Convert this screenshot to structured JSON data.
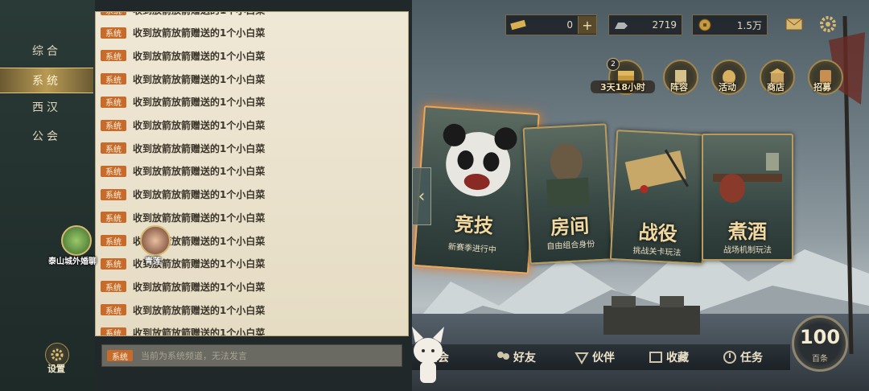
{
  "resources": [
    {
      "icon": "gold-bar-icon",
      "value": "0",
      "has_plus": true
    },
    {
      "icon": "horse-icon",
      "value": "2719",
      "has_plus": false
    },
    {
      "icon": "coin-icon",
      "value": "1.5万",
      "has_plus": false
    }
  ],
  "top_icons": [
    "mail-icon",
    "gear-icon"
  ],
  "menu_buttons": [
    {
      "label": "3天18小时",
      "icon": "chest-icon",
      "badge": "2"
    },
    {
      "label": "阵容",
      "icon": "formation-icon"
    },
    {
      "label": "活动",
      "icon": "lantern-icon"
    },
    {
      "label": "商店",
      "icon": "shop-icon"
    },
    {
      "label": "招募",
      "icon": "recruit-icon"
    }
  ],
  "cards": [
    {
      "title": "竞技",
      "subtitle": "新赛季进行中"
    },
    {
      "title": "房间",
      "subtitle": "自由组合身份"
    },
    {
      "title": "战役",
      "subtitle": "挑战关卡玩法"
    },
    {
      "title": "煮酒",
      "subtitle": "战场机制玩法"
    }
  ],
  "bottom_nav": [
    {
      "label": "公会",
      "icon": "guild-icon"
    },
    {
      "label": "好友",
      "icon": "friends-icon"
    },
    {
      "label": "伙伴",
      "icon": "partner-icon"
    },
    {
      "label": "收藏",
      "icon": "collection-icon"
    },
    {
      "label": "任务",
      "icon": "task-icon"
    }
  ],
  "counter": {
    "value": "100",
    "label": "百条"
  },
  "chat": {
    "tabs": [
      "综合",
      "系统",
      "西汉",
      "公会"
    ],
    "active_tab": "系统",
    "messages": [
      {
        "tag": "系统",
        "text": "收到放箭放箭赠送的1个小白菜"
      },
      {
        "tag": "系统",
        "text": "收到放箭放箭赠送的1个小白菜"
      },
      {
        "tag": "系统",
        "text": "收到放箭放箭赠送的1个小白菜"
      },
      {
        "tag": "系统",
        "text": "收到放箭放箭赠送的1个小白菜"
      },
      {
        "tag": "系统",
        "text": "收到放箭放箭赠送的1个小白菜"
      },
      {
        "tag": "系统",
        "text": "收到放箭放箭赠送的1个小白菜"
      },
      {
        "tag": "系统",
        "text": "收到放箭放箭赠送的1个小白菜"
      },
      {
        "tag": "系统",
        "text": "收到放箭放箭赠送的1个小白菜"
      },
      {
        "tag": "系统",
        "text": "收到放箭放箭赠送的1个小白菜"
      },
      {
        "tag": "系统",
        "text": "收到放箭放箭赠送的1个小白菜"
      },
      {
        "tag": "系统",
        "text": "收到放箭放箭赠送的1个小白菜"
      },
      {
        "tag": "系统",
        "text": "收到放箭放箭赠送的1个小白菜"
      },
      {
        "tag": "系统",
        "text": "收到放箭放箭赠送的1个小白菜"
      },
      {
        "tag": "系统",
        "text": "收到放箭放箭赠送的1个小白菜"
      },
      {
        "tag": "系统",
        "text": "收到放箭放箭赠送的1个小白菜"
      }
    ],
    "input_tag": "系统",
    "input_placeholder": "当前为系统频道，无法发言"
  },
  "players": [
    {
      "name": "泰山城外婚聊"
    },
    {
      "name": "青莲"
    }
  ],
  "settings_label": "设置",
  "colors": {
    "accent_gold": "#b89c5e",
    "system_tag": "#c86a2a",
    "card_glow": "#e07a30"
  }
}
